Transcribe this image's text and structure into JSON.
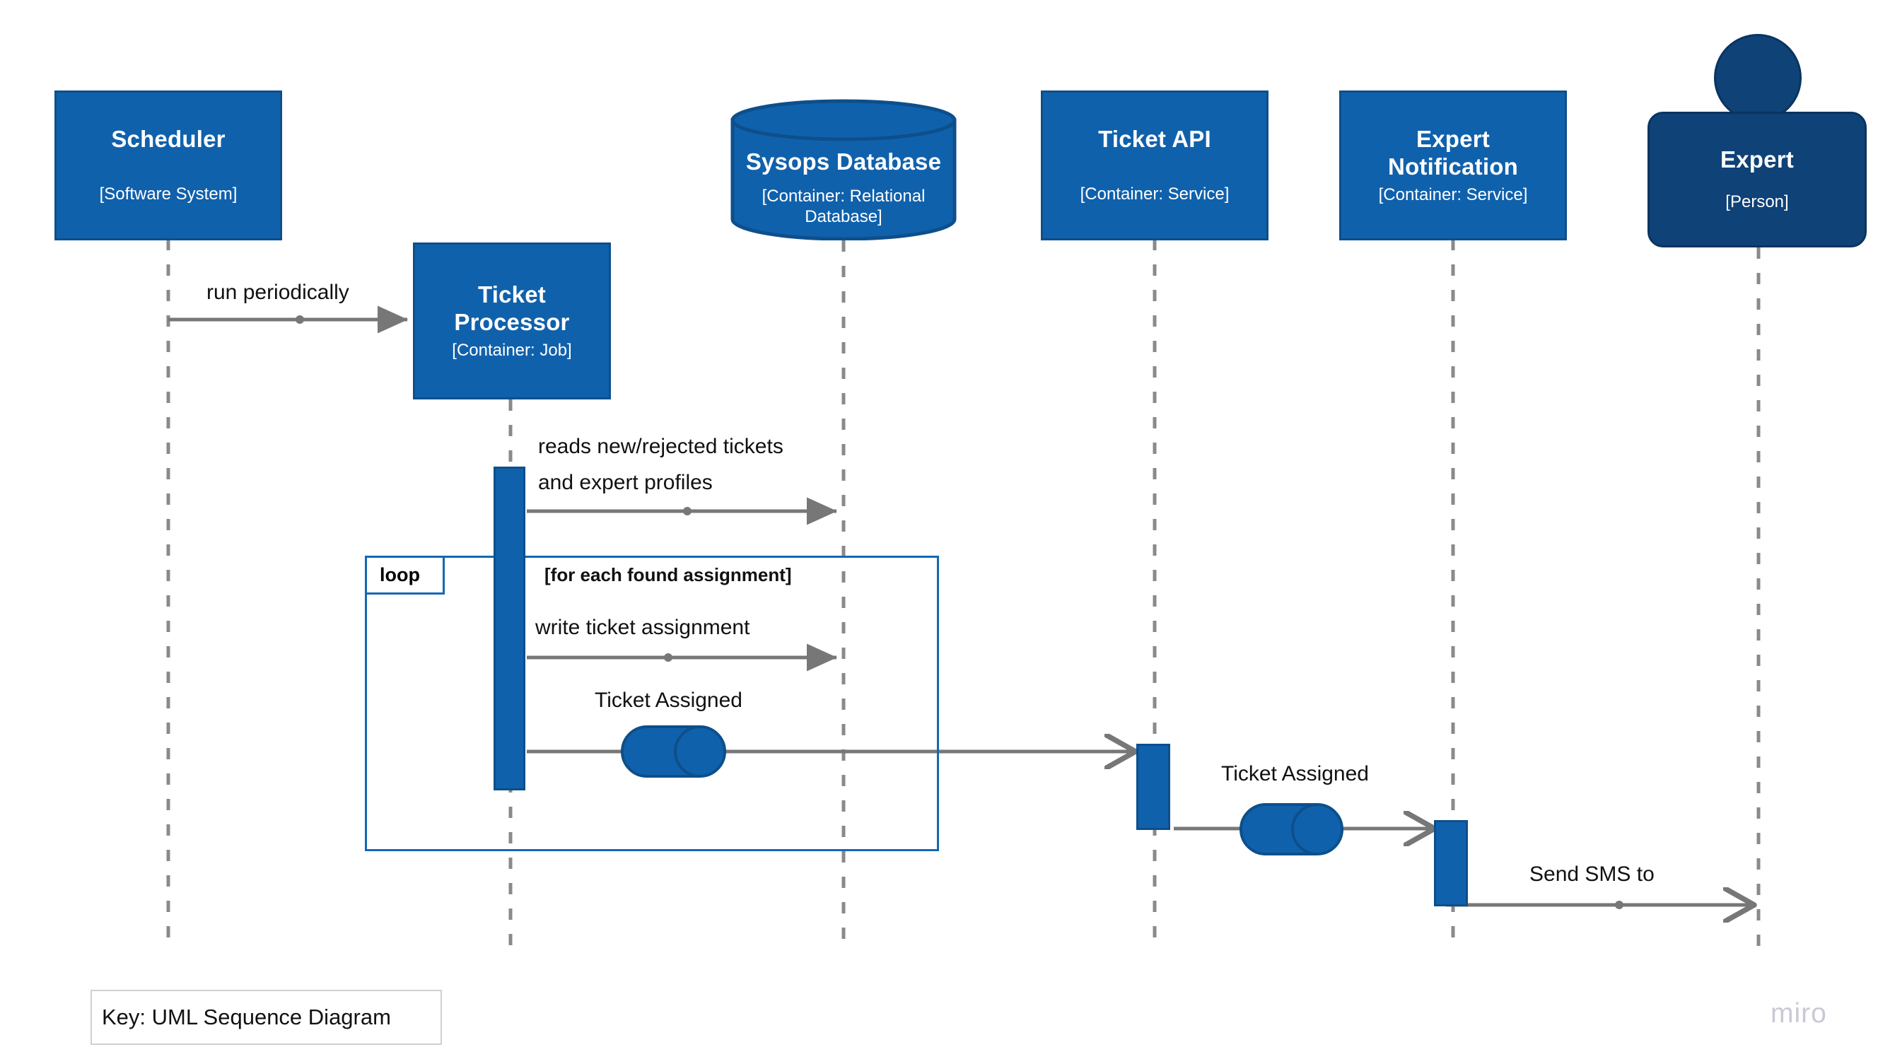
{
  "diagram": {
    "type": "UML Sequence Diagram",
    "key_label": "Key: UML Sequence Diagram",
    "watermark": "miro",
    "colors": {
      "element_fill": "#1061ac",
      "element_border": "#0d4f8b",
      "person_fill": "#0f4277",
      "person_border": "#0a3460",
      "arrow": "#777777",
      "fragment_border": "#1468b3",
      "lifeline": "#888888",
      "text_dark": "#111111",
      "text_light": "#ffffff",
      "watermark": "#c9c9d6"
    }
  },
  "participants": [
    {
      "id": "scheduler",
      "name": "Scheduler",
      "tech": "[Software System]",
      "shape": "box"
    },
    {
      "id": "processor",
      "name": "Ticket Processor",
      "tech": "[Container: Job]",
      "shape": "box"
    },
    {
      "id": "database",
      "name": "Sysops Database",
      "tech": "[Container: Relational Database]",
      "shape": "cylinder"
    },
    {
      "id": "ticketapi",
      "name": "Ticket API",
      "tech": "[Container: Service]",
      "shape": "box"
    },
    {
      "id": "expertnotif",
      "name": "Expert Notification",
      "tech": "[Container: Service]",
      "shape": "box"
    },
    {
      "id": "expert",
      "name": "Expert",
      "tech": "[Person]",
      "shape": "person"
    }
  ],
  "participant_labels": {
    "scheduler_name": "Scheduler",
    "scheduler_tech": "[Software System]",
    "processor_name_1": "Ticket",
    "processor_name_2": "Processor",
    "processor_tech": "[Container: Job]",
    "database_name": "Sysops Database",
    "database_tech_1": "[Container: Relational",
    "database_tech_2": "Database]",
    "ticketapi_name": "Ticket API",
    "ticketapi_tech": "[Container: Service]",
    "expertnotif_name_1": "Expert",
    "expertnotif_name_2": "Notification",
    "expertnotif_tech": "[Container: Service]",
    "expert_name": "Expert",
    "expert_tech": "[Person]"
  },
  "fragment": {
    "operator": "loop",
    "guard": "[for each found assignment]"
  },
  "messages": [
    {
      "id": "m1",
      "from": "scheduler",
      "to": "processor",
      "label": "run periodically",
      "arrowhead": "filled"
    },
    {
      "id": "m2",
      "from": "processor",
      "to": "database",
      "label_line1": "reads new/rejected tickets",
      "label_line2": "and expert profiles",
      "arrowhead": "filled"
    },
    {
      "id": "m3",
      "from": "processor",
      "to": "database",
      "label": "write ticket assignment",
      "arrowhead": "filled"
    },
    {
      "id": "m4",
      "from": "processor",
      "to": "ticketapi",
      "label": "Ticket Assigned",
      "arrowhead": "open",
      "queue": true
    },
    {
      "id": "m5",
      "from": "ticketapi",
      "to": "expertnotif",
      "label": "Ticket Assigned",
      "arrowhead": "open",
      "queue": true
    },
    {
      "id": "m6",
      "from": "expertnotif",
      "to": "expert",
      "label": "Send SMS to",
      "arrowhead": "open"
    }
  ],
  "message_labels": {
    "run_periodically": "run periodically",
    "reads_line1": "reads new/rejected tickets",
    "reads_line2": "and expert profiles",
    "write_ticket_assignment": "write ticket assignment",
    "ticket_assigned_1": "Ticket Assigned",
    "ticket_assigned_2": "Ticket Assigned",
    "send_sms_to": "Send SMS to"
  }
}
